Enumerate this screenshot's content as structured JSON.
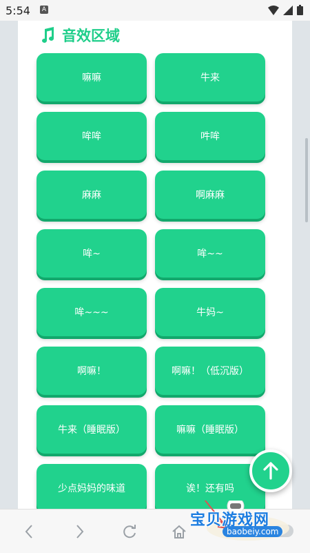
{
  "status_bar": {
    "time": "5:54",
    "badge": "A"
  },
  "section": {
    "title": "音效区域",
    "icon": "music-note-icon"
  },
  "buttons": [
    "嘛嘛",
    "牛来",
    "哞哞",
    "吽哞",
    "麻麻",
    "啊麻麻",
    "哞~",
    "哞~~",
    "哞~~~",
    "牛妈~",
    "啊嘛！",
    "啊嘛！（低沉版）",
    "牛来（睡眠版）",
    "嘛嘛（睡眠版）",
    "少点妈妈的味道",
    "诶！还有吗"
  ],
  "watermark": {
    "line1": "宝贝游戏网",
    "line2": "baobeiy.com"
  },
  "colors": {
    "accent": "#21d28d",
    "accent_dark": "#12a86c"
  }
}
